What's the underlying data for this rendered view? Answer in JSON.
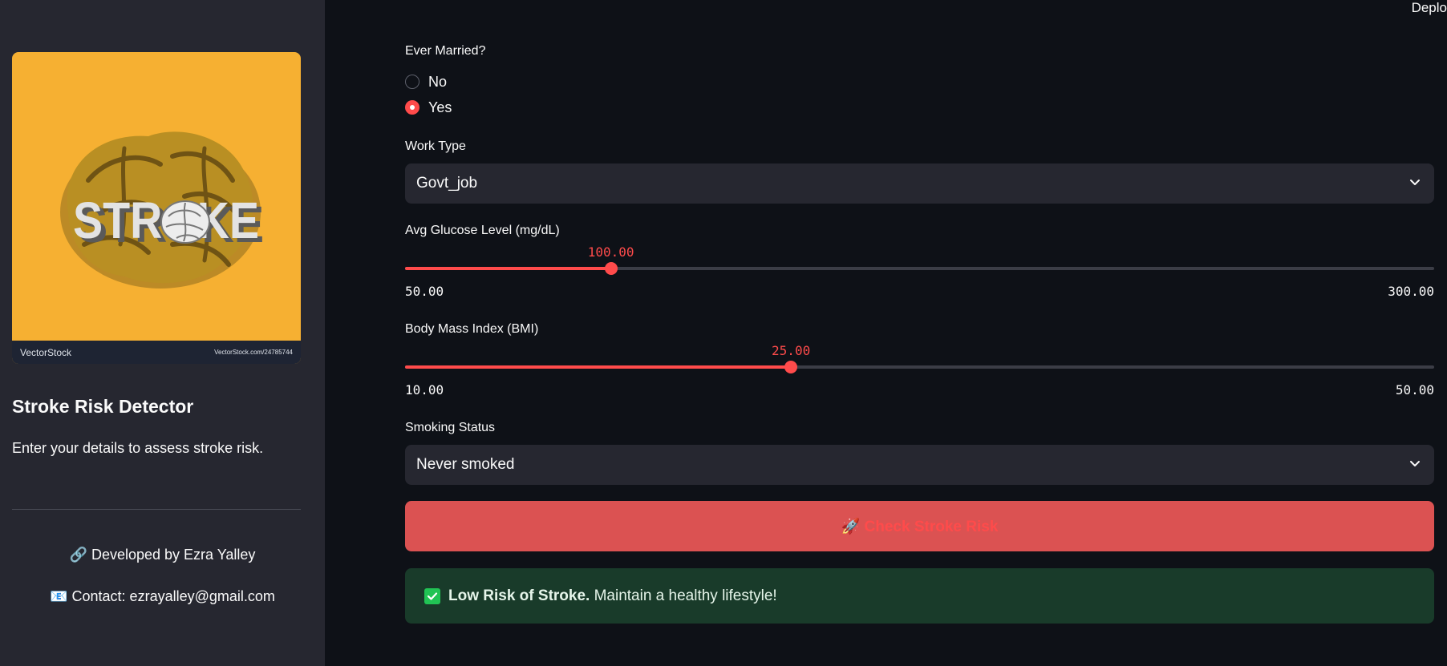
{
  "topbar": {
    "deploy_label": "Deplo"
  },
  "sidebar": {
    "logo": {
      "word": "STROKE",
      "brand": "VectorStock",
      "url": "VectorStock.com/24785744"
    },
    "title": "Stroke Risk Detector",
    "description": "Enter your details to assess stroke risk.",
    "developed_by": "🔗 Developed by Ezra Yalley",
    "contact": "📧 Contact: ezrayalley@gmail.com"
  },
  "form": {
    "ever_married": {
      "label": "Ever Married?",
      "options": [
        {
          "label": "No",
          "selected": false
        },
        {
          "label": "Yes",
          "selected": true
        }
      ]
    },
    "work_type": {
      "label": "Work Type",
      "value": "Govt_job"
    },
    "glucose": {
      "label": "Avg Glucose Level (mg/dL)",
      "value": 100,
      "value_text": "100.00",
      "min": 50,
      "max": 300,
      "min_text": "50.00",
      "max_text": "300.00"
    },
    "bmi": {
      "label": "Body Mass Index (BMI)",
      "value": 25,
      "value_text": "25.00",
      "min": 10,
      "max": 50,
      "min_text": "10.00",
      "max_text": "50.00"
    },
    "smoking_status": {
      "label": "Smoking Status",
      "value": "Never smoked"
    },
    "submit": {
      "label": "🚀 Check Stroke Risk"
    }
  },
  "result": {
    "bold": "Low Risk of Stroke.",
    "text": " Maintain a healthy lifestyle!"
  },
  "colors": {
    "accent": "#ff4b4b",
    "button_bg": "#db5252",
    "success_bg": "#193b2a",
    "sidebar_bg": "#262730",
    "app_bg": "#0e1117",
    "logo_bg": "#f6b032"
  }
}
